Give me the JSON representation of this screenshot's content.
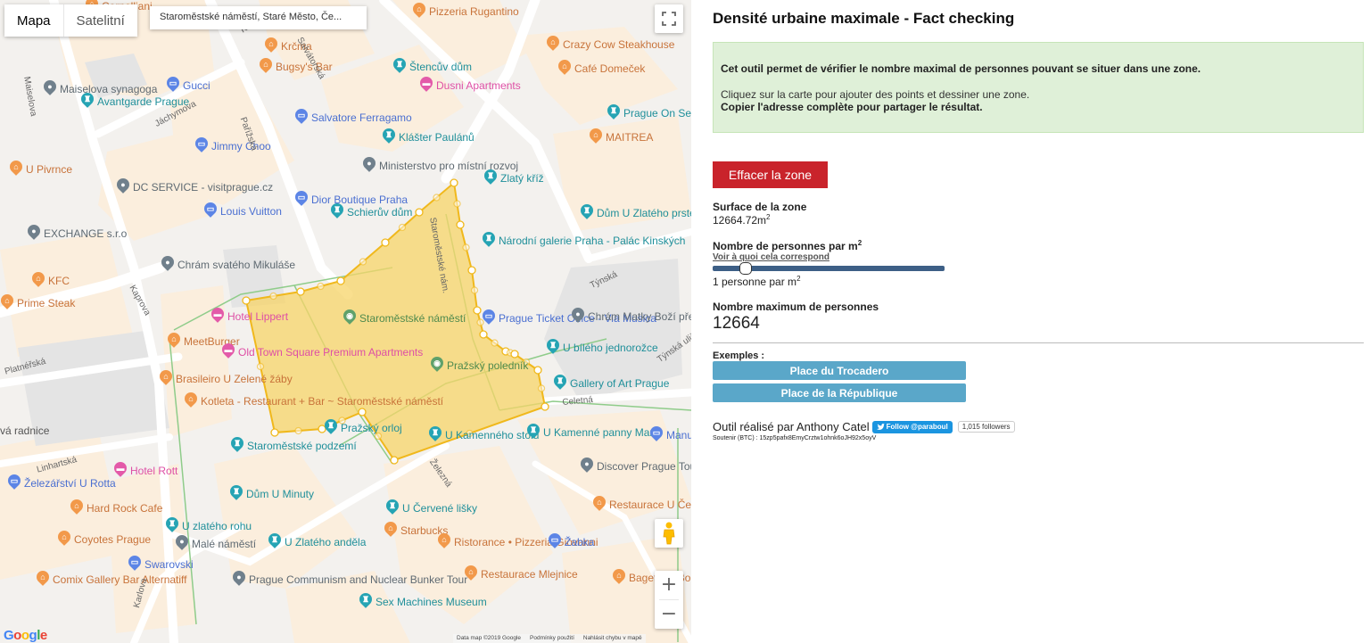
{
  "map": {
    "type_buttons": [
      {
        "label": "Mapa",
        "active": true
      },
      {
        "label": "Satelitní",
        "active": false
      }
    ],
    "address": "Staroměstské náměstí, Staré Město, Če...",
    "fullscreen_icon": "fullscreen-icon",
    "pegman_icon": "street-view-pegman-icon",
    "zoom_in": "+",
    "zoom_out": "−",
    "google_logo": "Google",
    "attribution": [
      "Data map ©2019 Google",
      "Podmínky použití",
      "Nahlásit chybu v mapě"
    ],
    "zone_color": "#f5c842",
    "pois": [
      {
        "name": "Cornelliani",
        "kind": "orange"
      },
      {
        "name": "Pizzeria Rugantino",
        "kind": "orange"
      },
      {
        "name": "Krčma",
        "kind": "orange"
      },
      {
        "name": "Bugsy's Bar",
        "kind": "orange"
      },
      {
        "name": "Štencův dům",
        "kind": "teal"
      },
      {
        "name": "Dusni Apartments",
        "kind": "pink"
      },
      {
        "name": "Crazy Cow Steakhouse",
        "kind": "orange"
      },
      {
        "name": "Café Domeček",
        "kind": "orange"
      },
      {
        "name": "Maiselova synagoga",
        "kind": "gray"
      },
      {
        "name": "Gucci",
        "kind": "blue"
      },
      {
        "name": "Avantgarde Prague",
        "kind": "teal"
      },
      {
        "name": "Salvatore Ferragamo",
        "kind": "blue"
      },
      {
        "name": "Klášter Paulánů",
        "kind": "teal"
      },
      {
        "name": "Jimmy Choo",
        "kind": "blue"
      },
      {
        "name": "MAITREA",
        "kind": "orange"
      },
      {
        "name": "Prague On Segway - Prague on E-Scooter",
        "kind": "teal"
      },
      {
        "name": "U Pivrnce",
        "kind": "orange"
      },
      {
        "name": "Ministerstvo pro místní rozvoj",
        "kind": "gray"
      },
      {
        "name": "Zlatý kříž",
        "kind": "teal"
      },
      {
        "name": "DC SERVICE - visitprague.cz",
        "kind": "gray"
      },
      {
        "name": "Dior Boutique Praha",
        "kind": "blue"
      },
      {
        "name": "Schierův dům",
        "kind": "teal"
      },
      {
        "name": "Louis Vuitton",
        "kind": "blue"
      },
      {
        "name": "Dům U Zlatého prstenu",
        "kind": "teal"
      },
      {
        "name": "EXCHANGE s.r.o",
        "kind": "gray"
      },
      {
        "name": "Národní galerie Praha - Palác Kinských",
        "kind": "teal"
      },
      {
        "name": "Chrám svatého Mikuláše",
        "kind": "gray"
      },
      {
        "name": "KFC",
        "kind": "orange"
      },
      {
        "name": "Prime Steak",
        "kind": "orange"
      },
      {
        "name": "Hotel Lippert",
        "kind": "pink"
      },
      {
        "name": "Staroměstské náměstí",
        "kind": "green"
      },
      {
        "name": "Prague Ticket Office - Via Musica",
        "kind": "blue"
      },
      {
        "name": "Chrám Matky Boží před Týnem",
        "kind": "gray"
      },
      {
        "name": "MeetBurger",
        "kind": "orange"
      },
      {
        "name": "Old Town Square Premium Apartments",
        "kind": "pink"
      },
      {
        "name": "U bílého jednorožce",
        "kind": "teal"
      },
      {
        "name": "Pražský orloj",
        "kind": "teal"
      },
      {
        "name": "Pražský poledník",
        "kind": "green"
      },
      {
        "name": "Brasileiro U Zelené žáby",
        "kind": "orange"
      },
      {
        "name": "Gallery of Art Prague",
        "kind": "teal"
      },
      {
        "name": "Kotleta - Restaurant + Bar ~ Staroměstské náměstí",
        "kind": "orange"
      },
      {
        "name": "U Kamenného stolu",
        "kind": "teal"
      },
      {
        "name": "U Kamenné panny Marie",
        "kind": "teal"
      },
      {
        "name": "Manufaktura",
        "kind": "blue"
      },
      {
        "name": "Staroměstské podzemí",
        "kind": "teal"
      },
      {
        "name": "Hotel Rott",
        "kind": "pink"
      },
      {
        "name": "Železářství U Rotta",
        "kind": "blue"
      },
      {
        "name": "Discover Prague Tours",
        "kind": "gray"
      },
      {
        "name": "Dům U Minuty",
        "kind": "teal"
      },
      {
        "name": "Restaurace U Černého Slunce",
        "kind": "orange"
      },
      {
        "name": "Hard Rock Cafe",
        "kind": "orange"
      },
      {
        "name": "U Červené lišky",
        "kind": "teal"
      },
      {
        "name": "Starbucks",
        "kind": "orange"
      },
      {
        "name": "U zlatého rohu",
        "kind": "teal"
      },
      {
        "name": "Coyotes Prague",
        "kind": "orange"
      },
      {
        "name": "Malé náměstí",
        "kind": "gray"
      },
      {
        "name": "U Zlatého anděla",
        "kind": "teal"
      },
      {
        "name": "Ristorance • Pizzeria Giovanni",
        "kind": "orange"
      },
      {
        "name": "Žabka",
        "kind": "blue"
      },
      {
        "name": "Restaurace Mlejnice",
        "kind": "orange"
      },
      {
        "name": "Bageterie Boulevard",
        "kind": "orange"
      },
      {
        "name": "Swarovski",
        "kind": "blue"
      },
      {
        "name": "Comix Gallery Bar Alternatiff",
        "kind": "orange"
      },
      {
        "name": "Prague Communism and Nuclear Bunker Tour",
        "kind": "gray"
      },
      {
        "name": "Sex Machines Museum",
        "kind": "teal"
      }
    ],
    "streets": [
      "Maiselova",
      "Kostečná",
      "Salvátorská",
      "Pařížská",
      "Jáchymova",
      "Kaprova",
      "Platnéřská",
      "Linhartská",
      "Karlova",
      "Týnská",
      "Týnská ulička",
      "Celetná",
      "Železná",
      "Staroměstské nám.",
      "vá radnice"
    ]
  },
  "panel": {
    "title": "Densité urbaine maximale - Fact checking",
    "info": {
      "line1": "Cet outil permet de vérifier le nombre maximal de personnes pouvant se situer dans une zone.",
      "line2": "Cliquez sur la carte pour ajouter des points et dessiner une zone.",
      "line3": "Copier l'adresse complète pour partager le résultat."
    },
    "clear_button": "Effacer la zone",
    "surface_label": "Surface de la zone",
    "surface_value": "12664.72m",
    "surface_unit_sup": "2",
    "density_label": "Nombre de personnes par m",
    "density_label_sup": "2",
    "density_link": "Voir à quoi cela correspond",
    "density_slider": {
      "value": 1,
      "min": 0,
      "max": 7
    },
    "density_value_text": "1 personne par m",
    "density_value_sup": "2",
    "max_label": "Nombre maximum de personnes",
    "max_value": "12664",
    "examples_label": "Exemples :",
    "examples": [
      "Place du Trocadero",
      "Place de la République"
    ],
    "credit_text": "Outil réalisé par Anthony Catel",
    "twitter_button": "Follow @paraboul",
    "twitter_followers": "1,015 followers",
    "btc_text": "Soutenir (BTC) : 15zp5pafx8EmyCrztw1ohnk6oJH92x5oyV"
  }
}
